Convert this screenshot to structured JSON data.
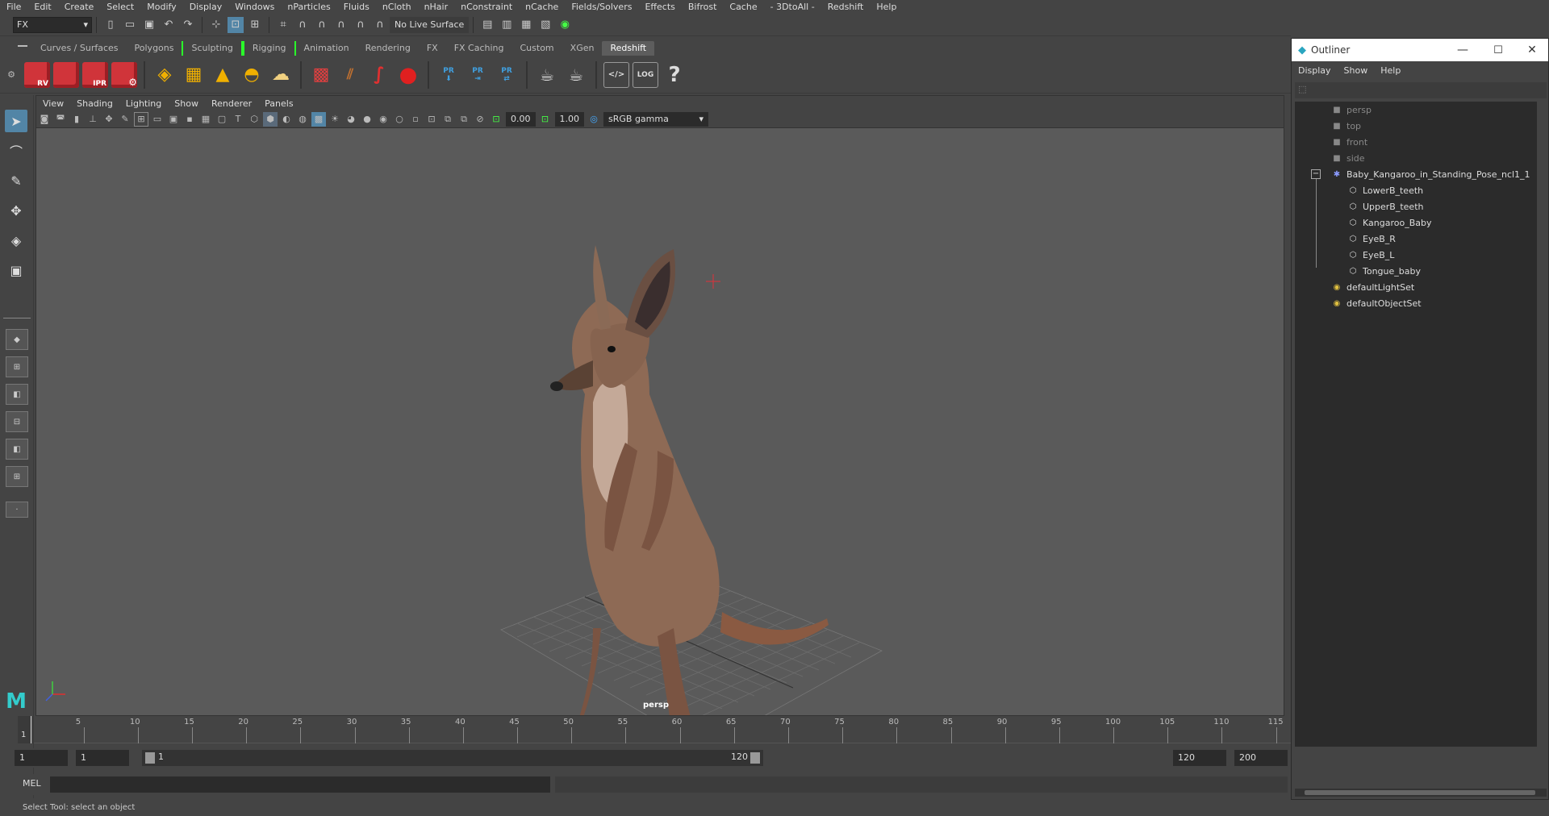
{
  "menubar": [
    "File",
    "Edit",
    "Create",
    "Select",
    "Modify",
    "Display",
    "Windows",
    "nParticles",
    "Fluids",
    "nCloth",
    "nHair",
    "nConstraint",
    "nCache",
    "Fields/Solvers",
    "Effects",
    "Bifrost",
    "Cache",
    "- 3DtoAll -",
    "Redshift",
    "Help"
  ],
  "statusline": {
    "mode": "FX",
    "live_surface": "No Live Surface"
  },
  "shelf_tabs": [
    "Curves / Surfaces",
    "Polygons",
    "Sculpting",
    "Rigging",
    "Animation",
    "Rendering",
    "FX",
    "FX Caching",
    "Custom",
    "XGen",
    "Redshift"
  ],
  "shelf_active_tab": "Redshift",
  "shelf_labels": {
    "rv": "RV",
    "ipr": "IPR",
    "pr1": "PR",
    "pr2": "PR",
    "pr3": "PR",
    "log": "LOG",
    "help": "?"
  },
  "viewport": {
    "menu": [
      "View",
      "Shading",
      "Lighting",
      "Show",
      "Renderer",
      "Panels"
    ],
    "exposure": "0.00",
    "gamma": "1.00",
    "color_space": "sRGB gamma",
    "camera_label": "persp"
  },
  "timeline": {
    "ticks": [
      "5",
      "10",
      "15",
      "20",
      "25",
      "30",
      "35",
      "40",
      "45",
      "50",
      "55",
      "60",
      "65",
      "70",
      "75",
      "80",
      "85",
      "90",
      "95",
      "100",
      "105",
      "110",
      "115"
    ],
    "current_frame": "1"
  },
  "range": {
    "start": "1",
    "playback_start": "1",
    "slider_start": "1",
    "slider_end": "120",
    "playback_end": "120",
    "end": "200"
  },
  "command": {
    "label": "MEL"
  },
  "help_line": "Select Tool: select an object",
  "outliner": {
    "title": "Outliner",
    "menu": [
      "Display",
      "Show",
      "Help"
    ],
    "items": [
      {
        "label": "persp",
        "type": "camera"
      },
      {
        "label": "top",
        "type": "camera"
      },
      {
        "label": "front",
        "type": "camera"
      },
      {
        "label": "side",
        "type": "camera"
      },
      {
        "label": "Baby_Kangaroo_in_Standing_Pose_ncl1_1",
        "type": "group"
      },
      {
        "label": "LowerB_teeth",
        "type": "mesh"
      },
      {
        "label": "UpperB_teeth",
        "type": "mesh"
      },
      {
        "label": "Kangaroo_Baby",
        "type": "mesh"
      },
      {
        "label": "EyeB_R",
        "type": "mesh"
      },
      {
        "label": "EyeB_L",
        "type": "mesh"
      },
      {
        "label": "Tongue_baby",
        "type": "mesh"
      },
      {
        "label": "defaultLightSet",
        "type": "set"
      },
      {
        "label": "defaultObjectSet",
        "type": "set"
      }
    ]
  }
}
